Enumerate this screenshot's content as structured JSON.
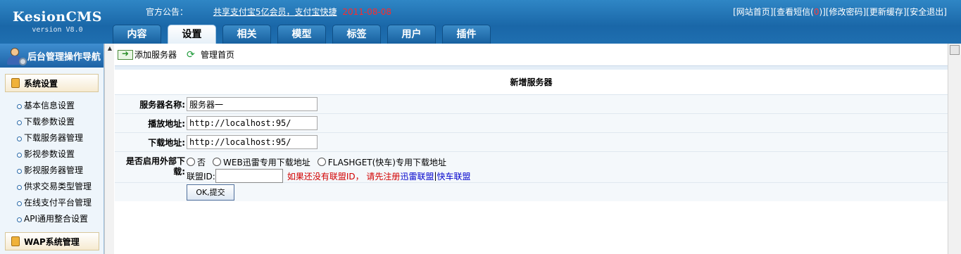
{
  "app": {
    "name": "KesionCMS",
    "version": "version V8.0"
  },
  "notice": {
    "label": "官方公告：",
    "text": "共享支付宝5亿会员，支付宝快捷",
    "date": "2011-08-08"
  },
  "top_links": {
    "home": "[网站首页]",
    "msg_prefix": "[查看短信(",
    "msg_count": "0",
    "msg_suffix": ")]",
    "password": "[修改密码]",
    "cache": "[更新缓存]",
    "logout": "[安全退出]"
  },
  "tabs": [
    {
      "label": "内容"
    },
    {
      "label": "设置"
    },
    {
      "label": "相关"
    },
    {
      "label": "模型"
    },
    {
      "label": "标签"
    },
    {
      "label": "用户"
    },
    {
      "label": "插件"
    }
  ],
  "sidebar": {
    "title": "后台管理操作导航",
    "section1": "系统设置",
    "items": [
      {
        "label": "基本信息设置"
      },
      {
        "label": "下载参数设置"
      },
      {
        "label": "下载服务器管理"
      },
      {
        "label": "影视参数设置"
      },
      {
        "label": "影视服务器管理"
      },
      {
        "label": "供求交易类型管理"
      },
      {
        "label": "在线支付平台管理"
      },
      {
        "label": "API通用整合设置"
      }
    ],
    "section2": "WAP系统管理"
  },
  "toolbar": {
    "add_server": "添加服务器",
    "manage_home": "管理首页"
  },
  "form": {
    "title": "新增服务器",
    "server_name_label": "服务器名称:",
    "server_name_value": "服务器一",
    "play_url_label": "播放地址:",
    "play_url_value": "http://localhost:95/",
    "download_url_label": "下载地址:",
    "download_url_value": "http://localhost:95/",
    "external_label": "是否启用外部下载:",
    "opt_no": "否",
    "opt_thunder": "WEB迅雷专用下载地址",
    "opt_flashget": "FLASHGET(快车)专用下载地址",
    "union_label": "联盟ID:",
    "union_value": "",
    "hint": "如果还没有联盟ID， 请先注册",
    "link_thunder": "迅雷联盟",
    "separator": "|",
    "link_flashget": "快车联盟",
    "submit": "OK,提交"
  }
}
